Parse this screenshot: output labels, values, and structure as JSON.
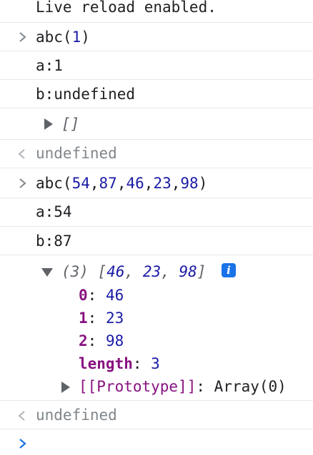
{
  "console": {
    "reload_msg": "Live reload enabled.",
    "cmd1": {
      "fn": "abc(",
      "args": [
        "1"
      ],
      "close": ")"
    },
    "log_a1": "a:1",
    "log_b1": "b:undefined",
    "empty_array": "[]",
    "result1": "undefined",
    "cmd2": {
      "fn": "abc(",
      "args": [
        "54",
        "87",
        "46",
        "23",
        "98"
      ],
      "sep": ",",
      "close": ")"
    },
    "log_a2": "a:54",
    "log_b2": "b:87",
    "array_preview": {
      "count": "(3)",
      "open": "[",
      "items": [
        "46",
        "23",
        "98"
      ],
      "item_sep": ", ",
      "close": "]"
    },
    "array_props": [
      {
        "key": "0",
        "colon": ": ",
        "value": "46"
      },
      {
        "key": "1",
        "colon": ": ",
        "value": "23"
      },
      {
        "key": "2",
        "colon": ": ",
        "value": "98"
      },
      {
        "key": "length",
        "colon": ": ",
        "value": "3"
      }
    ],
    "prototype": {
      "key": "[[Prototype]]",
      "colon": ": ",
      "value": "Array(0)"
    },
    "info_icon": "i",
    "result2": "undefined"
  },
  "icons": {
    "input_prompt": "chevron-right-icon",
    "result_prompt": "chevron-left-icon",
    "expand": "triangle-right-icon",
    "collapse": "triangle-down-icon",
    "info": "info-icon"
  },
  "colors": {
    "number": "#1a1aa6",
    "key": "#881280",
    "muted": "#80868b",
    "prompt_active": "#1a73e8",
    "info_badge": "#1a73e8"
  }
}
